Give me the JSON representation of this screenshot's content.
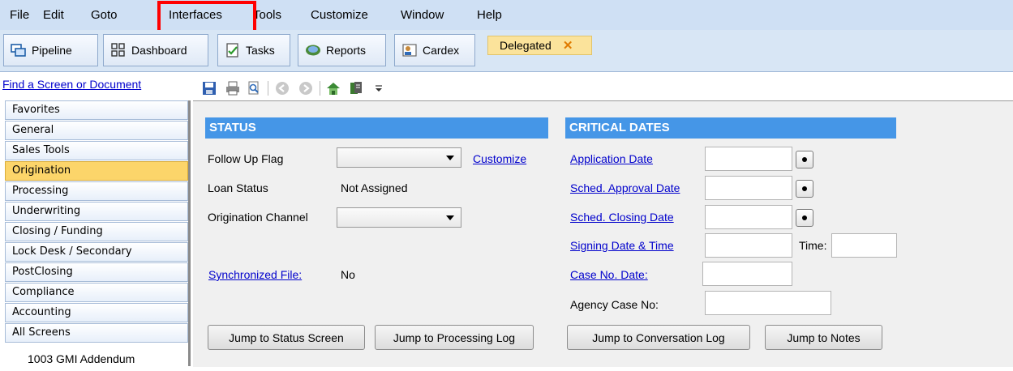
{
  "menu": [
    "File",
    "Edit",
    "Goto",
    "Interfaces",
    "Tools",
    "Customize",
    "Window",
    "Help"
  ],
  "toolbar": {
    "pipeline": "Pipeline",
    "dashboard": "Dashboard",
    "tasks": "Tasks",
    "reports": "Reports",
    "cardex": "Cardex",
    "delegated_tab": "Delegated",
    "close_glyph": "✕"
  },
  "sidebar": {
    "find_link": "Find a Screen or Document",
    "items": [
      "Favorites",
      "General",
      "Sales Tools",
      "Origination",
      "Processing",
      "Underwriting",
      "Closing / Funding",
      "Lock Desk / Secondary",
      "PostClosing",
      "Compliance",
      "Accounting",
      "All Screens"
    ],
    "active": "Origination",
    "sub_item": "1003 GMI Addendum"
  },
  "status": {
    "heading": "STATUS",
    "follow_up_label": "Follow Up Flag",
    "customize_link": "Customize",
    "loan_status_label": "Loan Status",
    "loan_status_value": "Not Assigned",
    "origination_channel_label": "Origination Channel",
    "synchronized_link": "Synchronized File:",
    "synchronized_value": "No"
  },
  "critical_dates": {
    "heading": "CRITICAL DATES",
    "application_date": "Application Date",
    "sched_approval": "Sched. Approval Date",
    "sched_closing": "Sched. Closing Date",
    "signing_date": "Signing Date & Time",
    "time_label": "Time:",
    "case_no_date": "Case No. Date:",
    "agency_case_no": "Agency Case No:"
  },
  "buttons": {
    "status_screen": "Jump to Status Screen",
    "processing_log": "Jump to Processing Log",
    "conversation_log": "Jump to Conversation Log",
    "notes": "Jump to Notes"
  },
  "colors": {
    "section_header": "#4596e7",
    "active_nav": "#fcd56a",
    "highlight": "#ff0000",
    "link": "#0000cc"
  }
}
